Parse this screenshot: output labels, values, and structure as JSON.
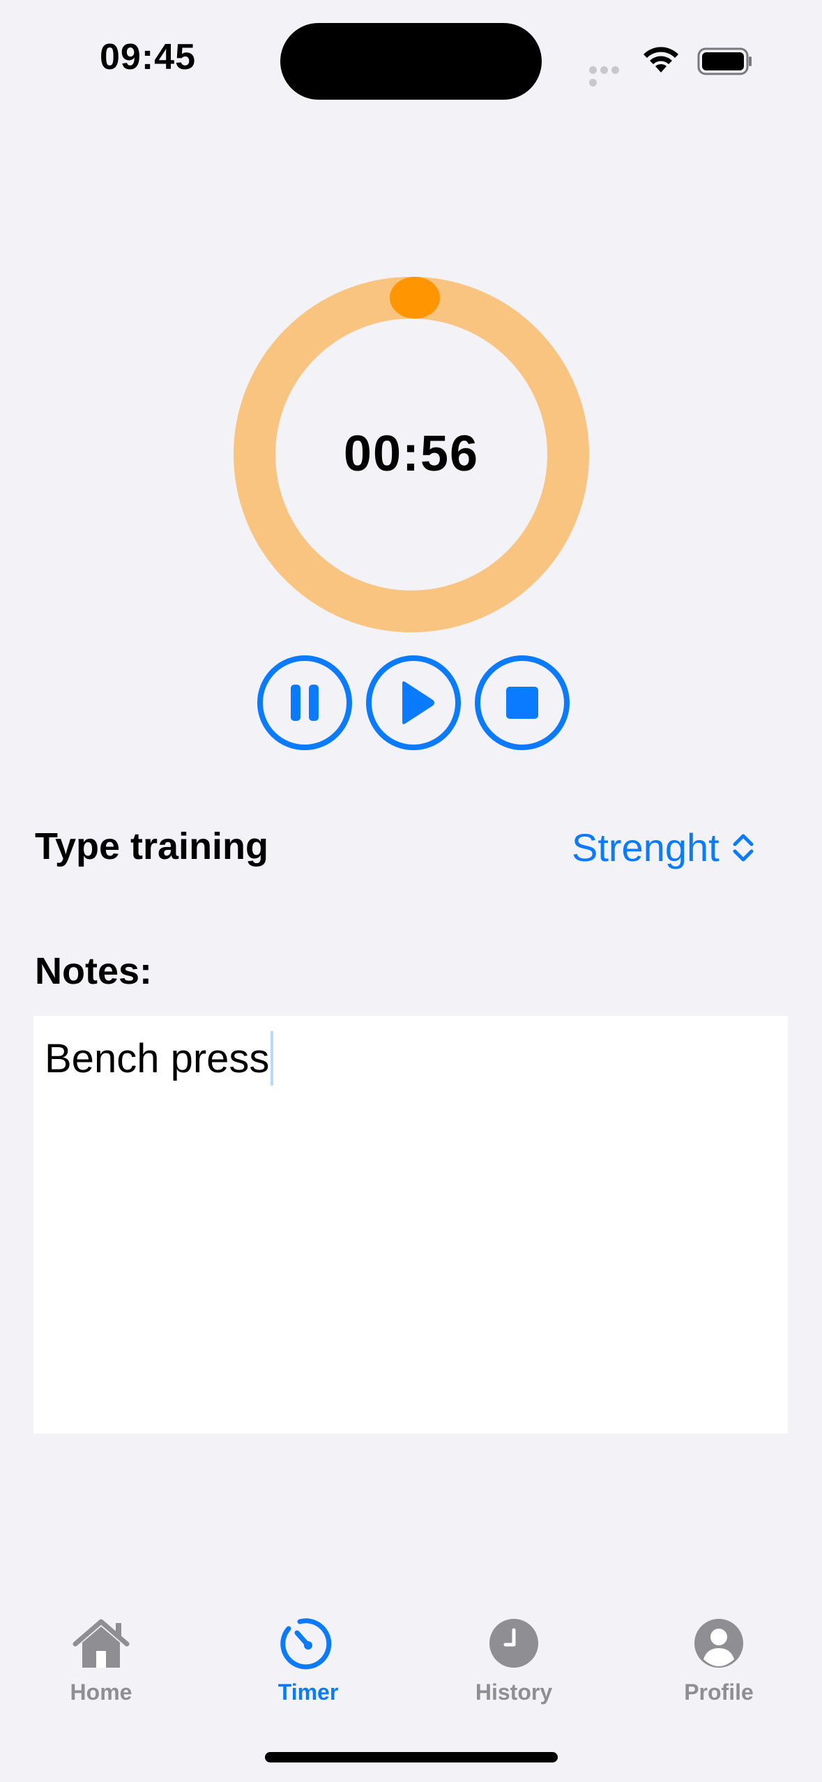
{
  "status_bar": {
    "time": "09:45"
  },
  "timer": {
    "display": "00:56",
    "track_color": "#f9c47f",
    "knob_color": "#ff9500"
  },
  "controls": {
    "pause_icon": "pause-icon",
    "play_icon": "play-icon",
    "stop_icon": "stop-icon",
    "accent_color": "#0a7aff"
  },
  "training": {
    "label": "Type training",
    "selected_value": "Strenght"
  },
  "notes": {
    "label": "Notes:",
    "value": "Bench press"
  },
  "tab_bar": {
    "items": [
      {
        "label": "Home",
        "icon": "house-icon",
        "active": false
      },
      {
        "label": "Timer",
        "icon": "timer-icon",
        "active": true
      },
      {
        "label": "History",
        "icon": "clock-icon",
        "active": false
      },
      {
        "label": "Profile",
        "icon": "person-icon",
        "active": false
      }
    ]
  }
}
